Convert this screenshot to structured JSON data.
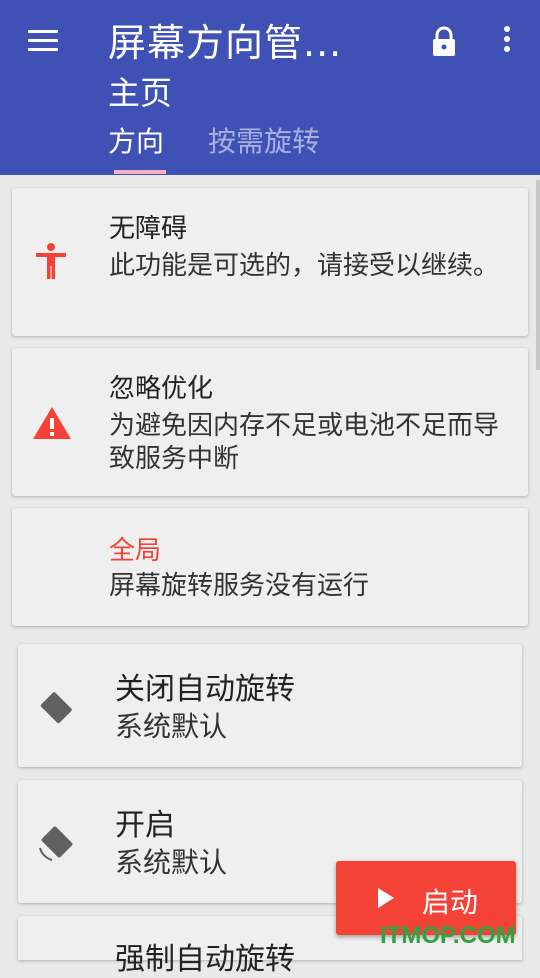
{
  "appbar": {
    "title": "屏幕方向管...",
    "subtitle": "主页",
    "tabs": [
      {
        "label": "方向",
        "active": true
      },
      {
        "label": "按需旋转",
        "active": false
      }
    ],
    "color": "#3f51b5",
    "icons": [
      "menu-icon",
      "lock-icon",
      "more-vert-icon"
    ]
  },
  "cards": [
    {
      "title": "无障碍",
      "desc": "此功能是可选的，请接受以继续。",
      "icon": "accessibility-icon"
    },
    {
      "title": "忽略优化",
      "desc": "为避免因内存不足或电池不足而导致服务中断",
      "icon": "warning-icon"
    },
    {
      "title": "全局",
      "desc": "屏幕旋转服务没有运行",
      "title_color": "#f44336"
    }
  ],
  "modes": [
    {
      "title": "关闭自动旋转",
      "desc": "系统默认",
      "icon": "rotation-locked-icon"
    },
    {
      "title": "开启",
      "desc": "系统默认",
      "icon": "auto-rotate-icon"
    },
    {
      "title": "强制自动旋转",
      "desc": "",
      "icon": "forced-rotate-icon"
    }
  ],
  "fab": {
    "label": "启动",
    "icon": "play-icon",
    "color": "#f44336"
  },
  "watermark": "ITMOP.COM"
}
